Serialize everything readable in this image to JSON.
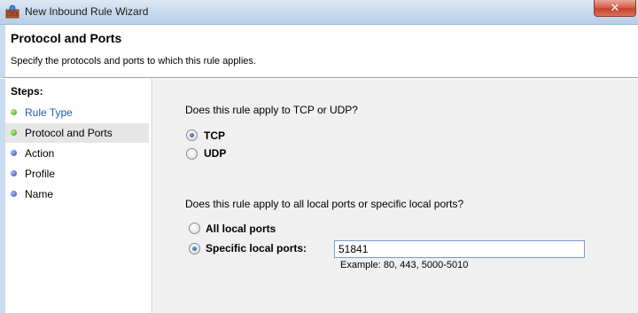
{
  "window": {
    "title": "New Inbound Rule Wizard",
    "close_glyph": "✕"
  },
  "header": {
    "title": "Protocol and Ports",
    "subtitle": "Specify the protocols and ports to which this rule applies."
  },
  "steps": {
    "title": "Steps:",
    "items": [
      {
        "label": "Rule Type",
        "status": "complete"
      },
      {
        "label": "Protocol and Ports",
        "status": "current"
      },
      {
        "label": "Action",
        "status": "pending"
      },
      {
        "label": "Profile",
        "status": "pending"
      },
      {
        "label": "Name",
        "status": "pending"
      }
    ]
  },
  "protocol": {
    "question": "Does this rule apply to TCP or UDP?",
    "options": [
      {
        "label": "TCP",
        "checked": true
      },
      {
        "label": "UDP",
        "checked": false
      }
    ]
  },
  "ports": {
    "question": "Does this rule apply to all local ports or specific local ports?",
    "options": [
      {
        "label": "All local ports",
        "checked": false
      },
      {
        "label": "Specific local ports:",
        "checked": true
      }
    ],
    "value": "51841",
    "example": "Example: 80, 443, 5000-5010"
  },
  "colors": {
    "step_complete": "#3b9a16",
    "step_pending": "#3149b8",
    "link": "#1f5ba6",
    "close": "#c7432b"
  },
  "icons": {
    "app": "firewall-wall-icon",
    "close": "close-icon"
  }
}
